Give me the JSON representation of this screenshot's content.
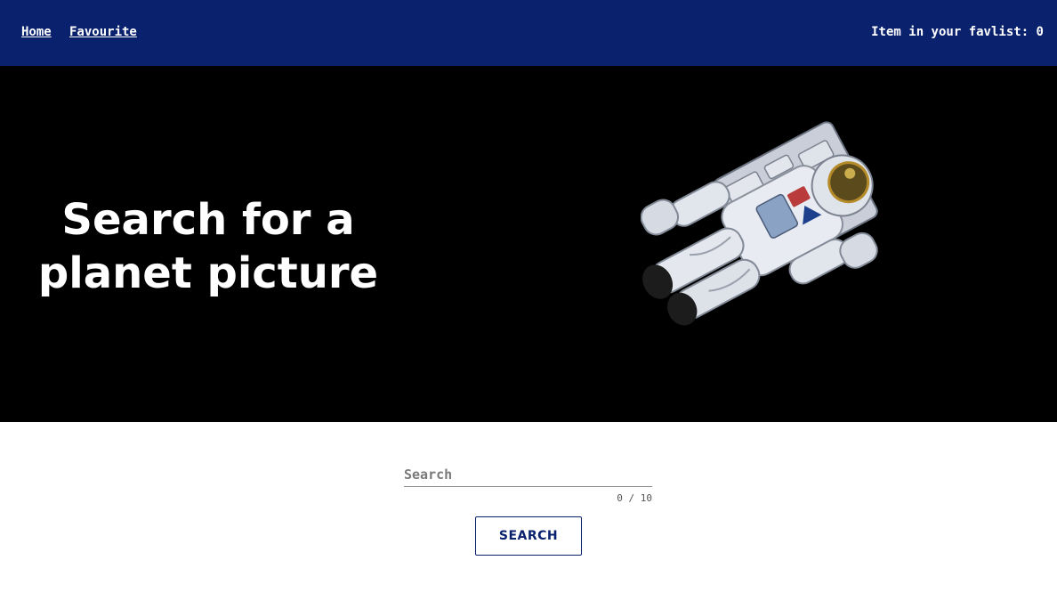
{
  "nav": {
    "home_label": "Home",
    "favourite_label": "Favourite",
    "favlist_label": "Item in your favlist: 0"
  },
  "hero": {
    "title_line1": "Search for a",
    "title_line2": "planet picture",
    "image_icon": "astronaut-illustration"
  },
  "search": {
    "placeholder": "Search",
    "value": "",
    "counter": "0 / 10",
    "button_label": "SEARCH"
  },
  "colors": {
    "nav_bg": "#0a226e",
    "hero_bg": "#000000",
    "accent": "#0a226e"
  }
}
